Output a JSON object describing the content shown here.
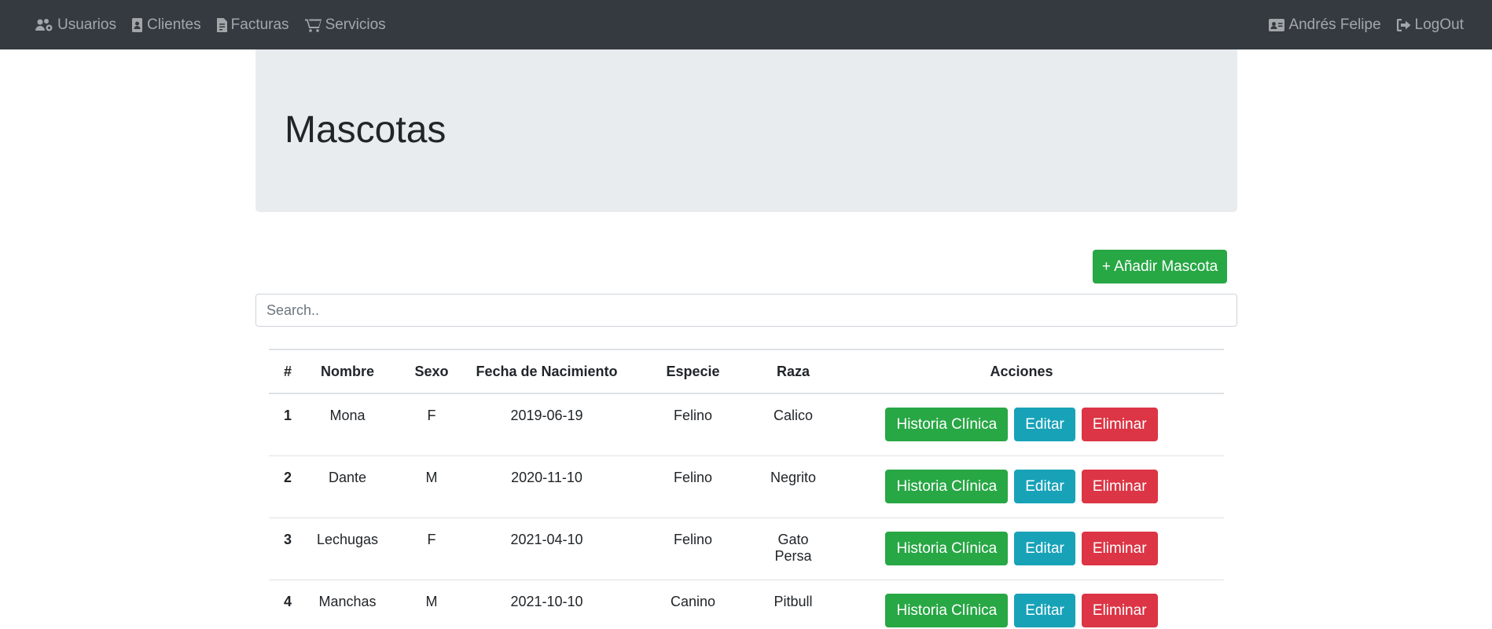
{
  "nav": {
    "left": [
      {
        "label": "Usuarios",
        "icon": "users-cog-icon"
      },
      {
        "label": "Clientes",
        "icon": "address-book-icon"
      },
      {
        "label": "Facturas",
        "icon": "file-invoice-icon"
      },
      {
        "label": "Servicios",
        "icon": "shopping-cart-icon"
      }
    ],
    "right": [
      {
        "label": "Andrés Felipe",
        "icon": "id-card-icon"
      },
      {
        "label": "LogOut",
        "icon": "sign-out-icon"
      }
    ]
  },
  "page": {
    "title": "Mascotas"
  },
  "toolbar": {
    "add_label": "+ Añadir Mascota"
  },
  "search": {
    "placeholder": "Search.."
  },
  "table": {
    "headers": [
      "#",
      "Nombre",
      "Sexo",
      "Fecha de Nacimiento",
      "Especie",
      "Raza",
      "Acciones"
    ],
    "rows": [
      {
        "id": "1",
        "nombre": "Mona",
        "sexo": "F",
        "fecha": "2019-06-19",
        "especie": "Felino",
        "raza": "Calico"
      },
      {
        "id": "2",
        "nombre": "Dante",
        "sexo": "M",
        "fecha": "2020-11-10",
        "especie": "Felino",
        "raza": "Negrito"
      },
      {
        "id": "3",
        "nombre": "Lechugas",
        "sexo": "F",
        "fecha": "2021-04-10",
        "especie": "Felino",
        "raza": "Gato Persa"
      },
      {
        "id": "4",
        "nombre": "Manchas",
        "sexo": "M",
        "fecha": "2021-10-10",
        "especie": "Canino",
        "raza": "Pitbull"
      }
    ],
    "actions": {
      "history": "Historia Clínica",
      "edit": "Editar",
      "delete": "Eliminar"
    }
  },
  "colors": {
    "navbar": "#343a40",
    "jumbotron": "#e9ecef",
    "success": "#28a745",
    "info": "#17a2b8",
    "danger": "#dc3545"
  }
}
